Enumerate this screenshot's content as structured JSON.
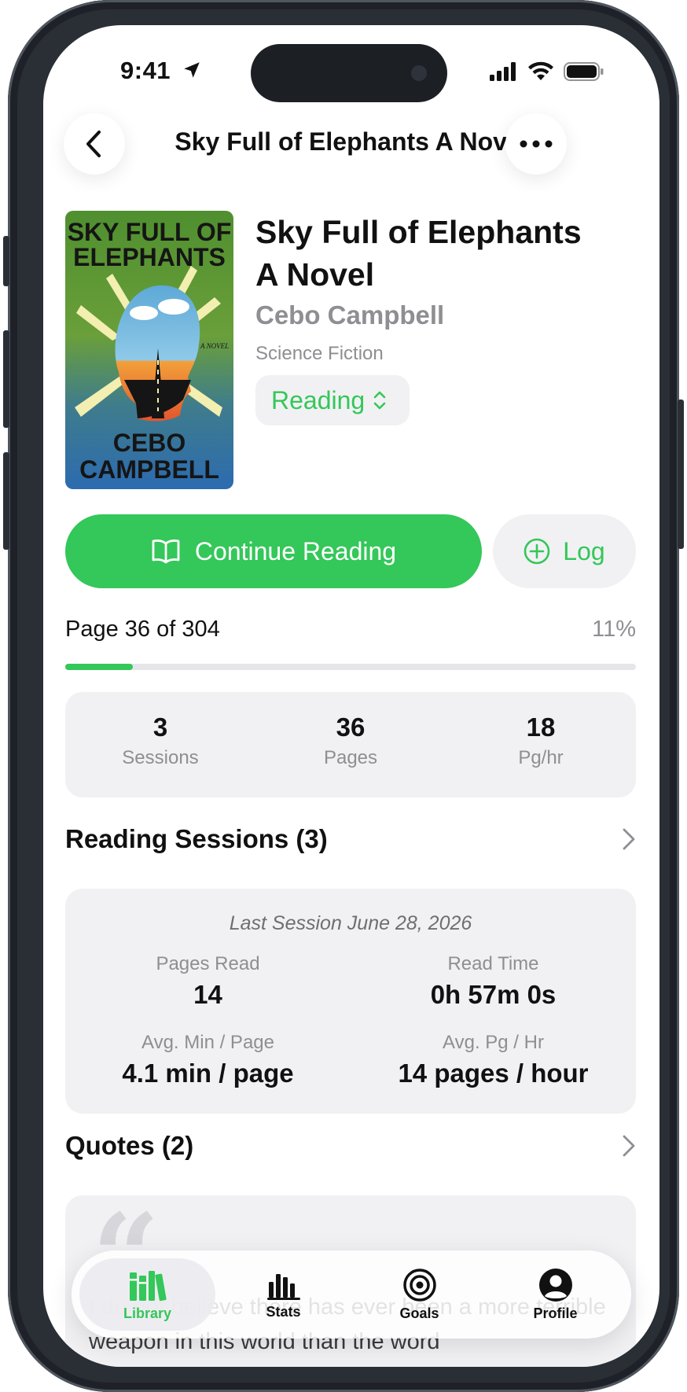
{
  "status_bar": {
    "time": "9:41"
  },
  "nav": {
    "title": "Sky Full of Elephants A Novel"
  },
  "book": {
    "title_line1": "Sky Full of Elephants",
    "title_line2": "A Novel",
    "author": "Cebo Campbell",
    "genre": "Science Fiction",
    "status": "Reading",
    "cover": {
      "line1": "SKY FULL OF",
      "line2": "ELEPHANTS",
      "line3": "CEBO",
      "line4": "CAMPBELL",
      "tag": "A NOVEL"
    }
  },
  "actions": {
    "continue_label": "Continue Reading",
    "log_label": "Log"
  },
  "progress": {
    "label": "Page 36 of 304",
    "percent_text": "11%",
    "fraction": 0.118
  },
  "stats": [
    {
      "value": "3",
      "label": "Sessions"
    },
    {
      "value": "36",
      "label": "Pages"
    },
    {
      "value": "18",
      "label": "Pg/hr"
    }
  ],
  "sessions": {
    "header": "Reading Sessions (3)",
    "last_session": "Last Session June 28, 2026",
    "pages_read_label": "Pages Read",
    "pages_read_value": "14",
    "read_time_label": "Read Time",
    "read_time_value": "0h 57m 0s",
    "avg_min_label": "Avg. Min / Page",
    "avg_min_value": "4.1 min / page",
    "avg_pg_label": "Avg. Pg / Hr",
    "avg_pg_value": "14 pages / hour"
  },
  "quotes": {
    "header": "Quotes (2)",
    "first_quote": "I do not believe there has ever been a more terrible weapon in this world than the word"
  },
  "tabs": [
    {
      "label": "Library",
      "icon": "library-icon",
      "active": true
    },
    {
      "label": "Stats",
      "icon": "stats-icon",
      "active": false
    },
    {
      "label": "Goals",
      "icon": "goals-icon",
      "active": false
    },
    {
      "label": "Profile",
      "icon": "profile-icon",
      "active": false
    }
  ],
  "colors": {
    "accent": "#34c759",
    "card": "#f1f1f4",
    "secondary_text": "#8e8e93"
  }
}
